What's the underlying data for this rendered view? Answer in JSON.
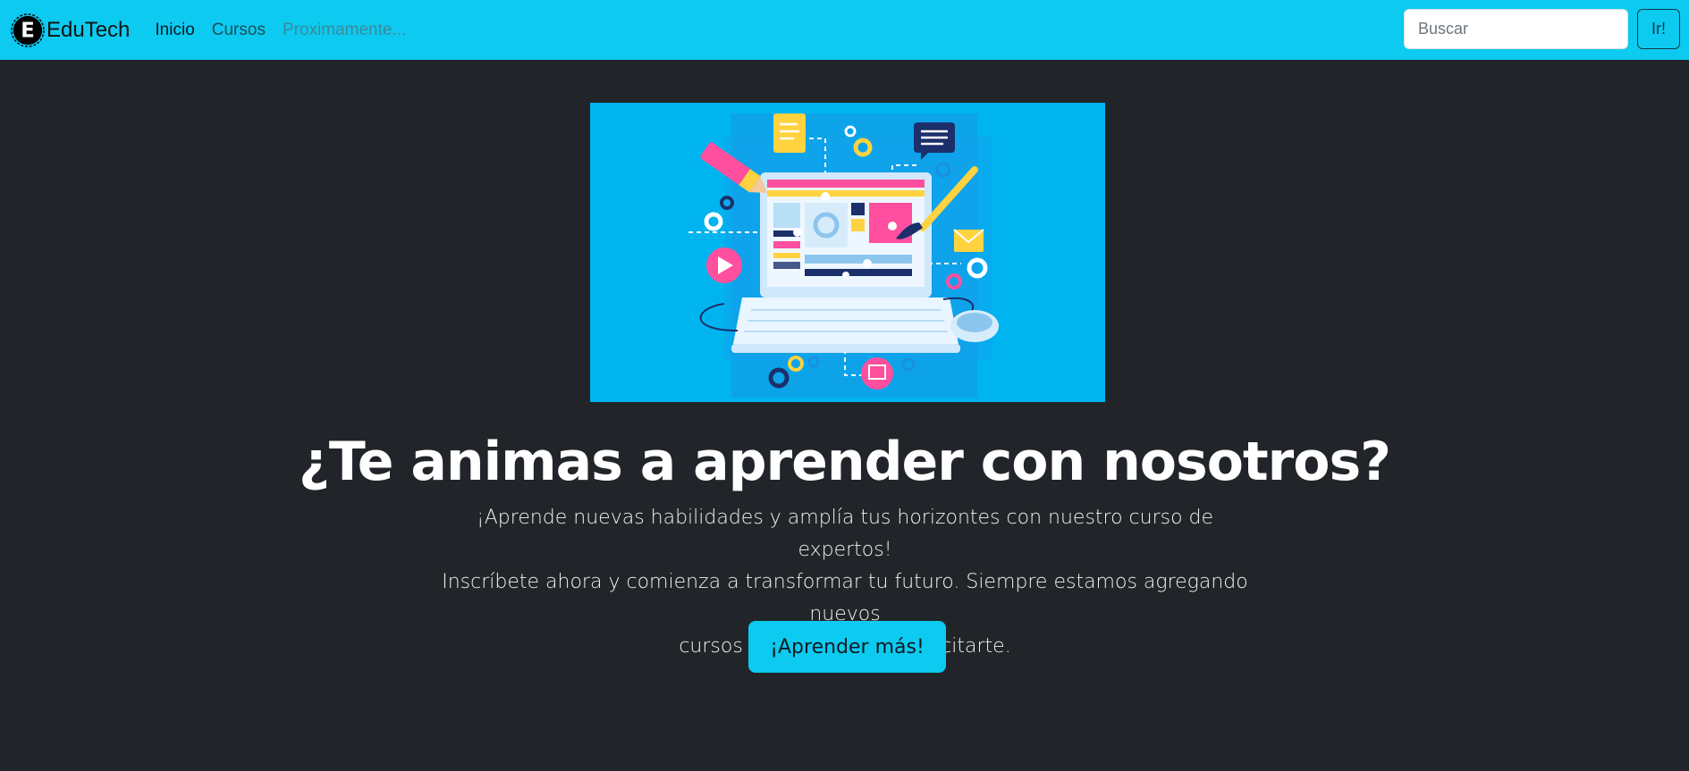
{
  "navbar": {
    "brand": "EduTech",
    "links": [
      {
        "label": "Inicio",
        "state": "active"
      },
      {
        "label": "Cursos",
        "state": "normal"
      },
      {
        "label": "Proximamente...",
        "state": "disabled"
      }
    ],
    "search": {
      "placeholder": "Buscar",
      "value": "",
      "button_label": "Ir!"
    }
  },
  "hero": {
    "image_icon": "laptop-web-design-illustration",
    "title": "¿Te animas a aprender con nosotros?",
    "lead_lines": [
      "¡Aprende nuevas habilidades y amplía tus horizontes con nuestro curso de expertos!",
      "Inscríbete ahora y comienza a transformar tu futuro. Siempre estamos agregando nuevos",
      "cursos para ayudar a capacitarte."
    ],
    "cta_label": "¡Aprender más!"
  },
  "colors": {
    "navbar_bg": "#0dcaf0",
    "page_bg": "#212529",
    "cta_bg": "#0dcaf0",
    "illustration_bg": "#00b4f0"
  }
}
